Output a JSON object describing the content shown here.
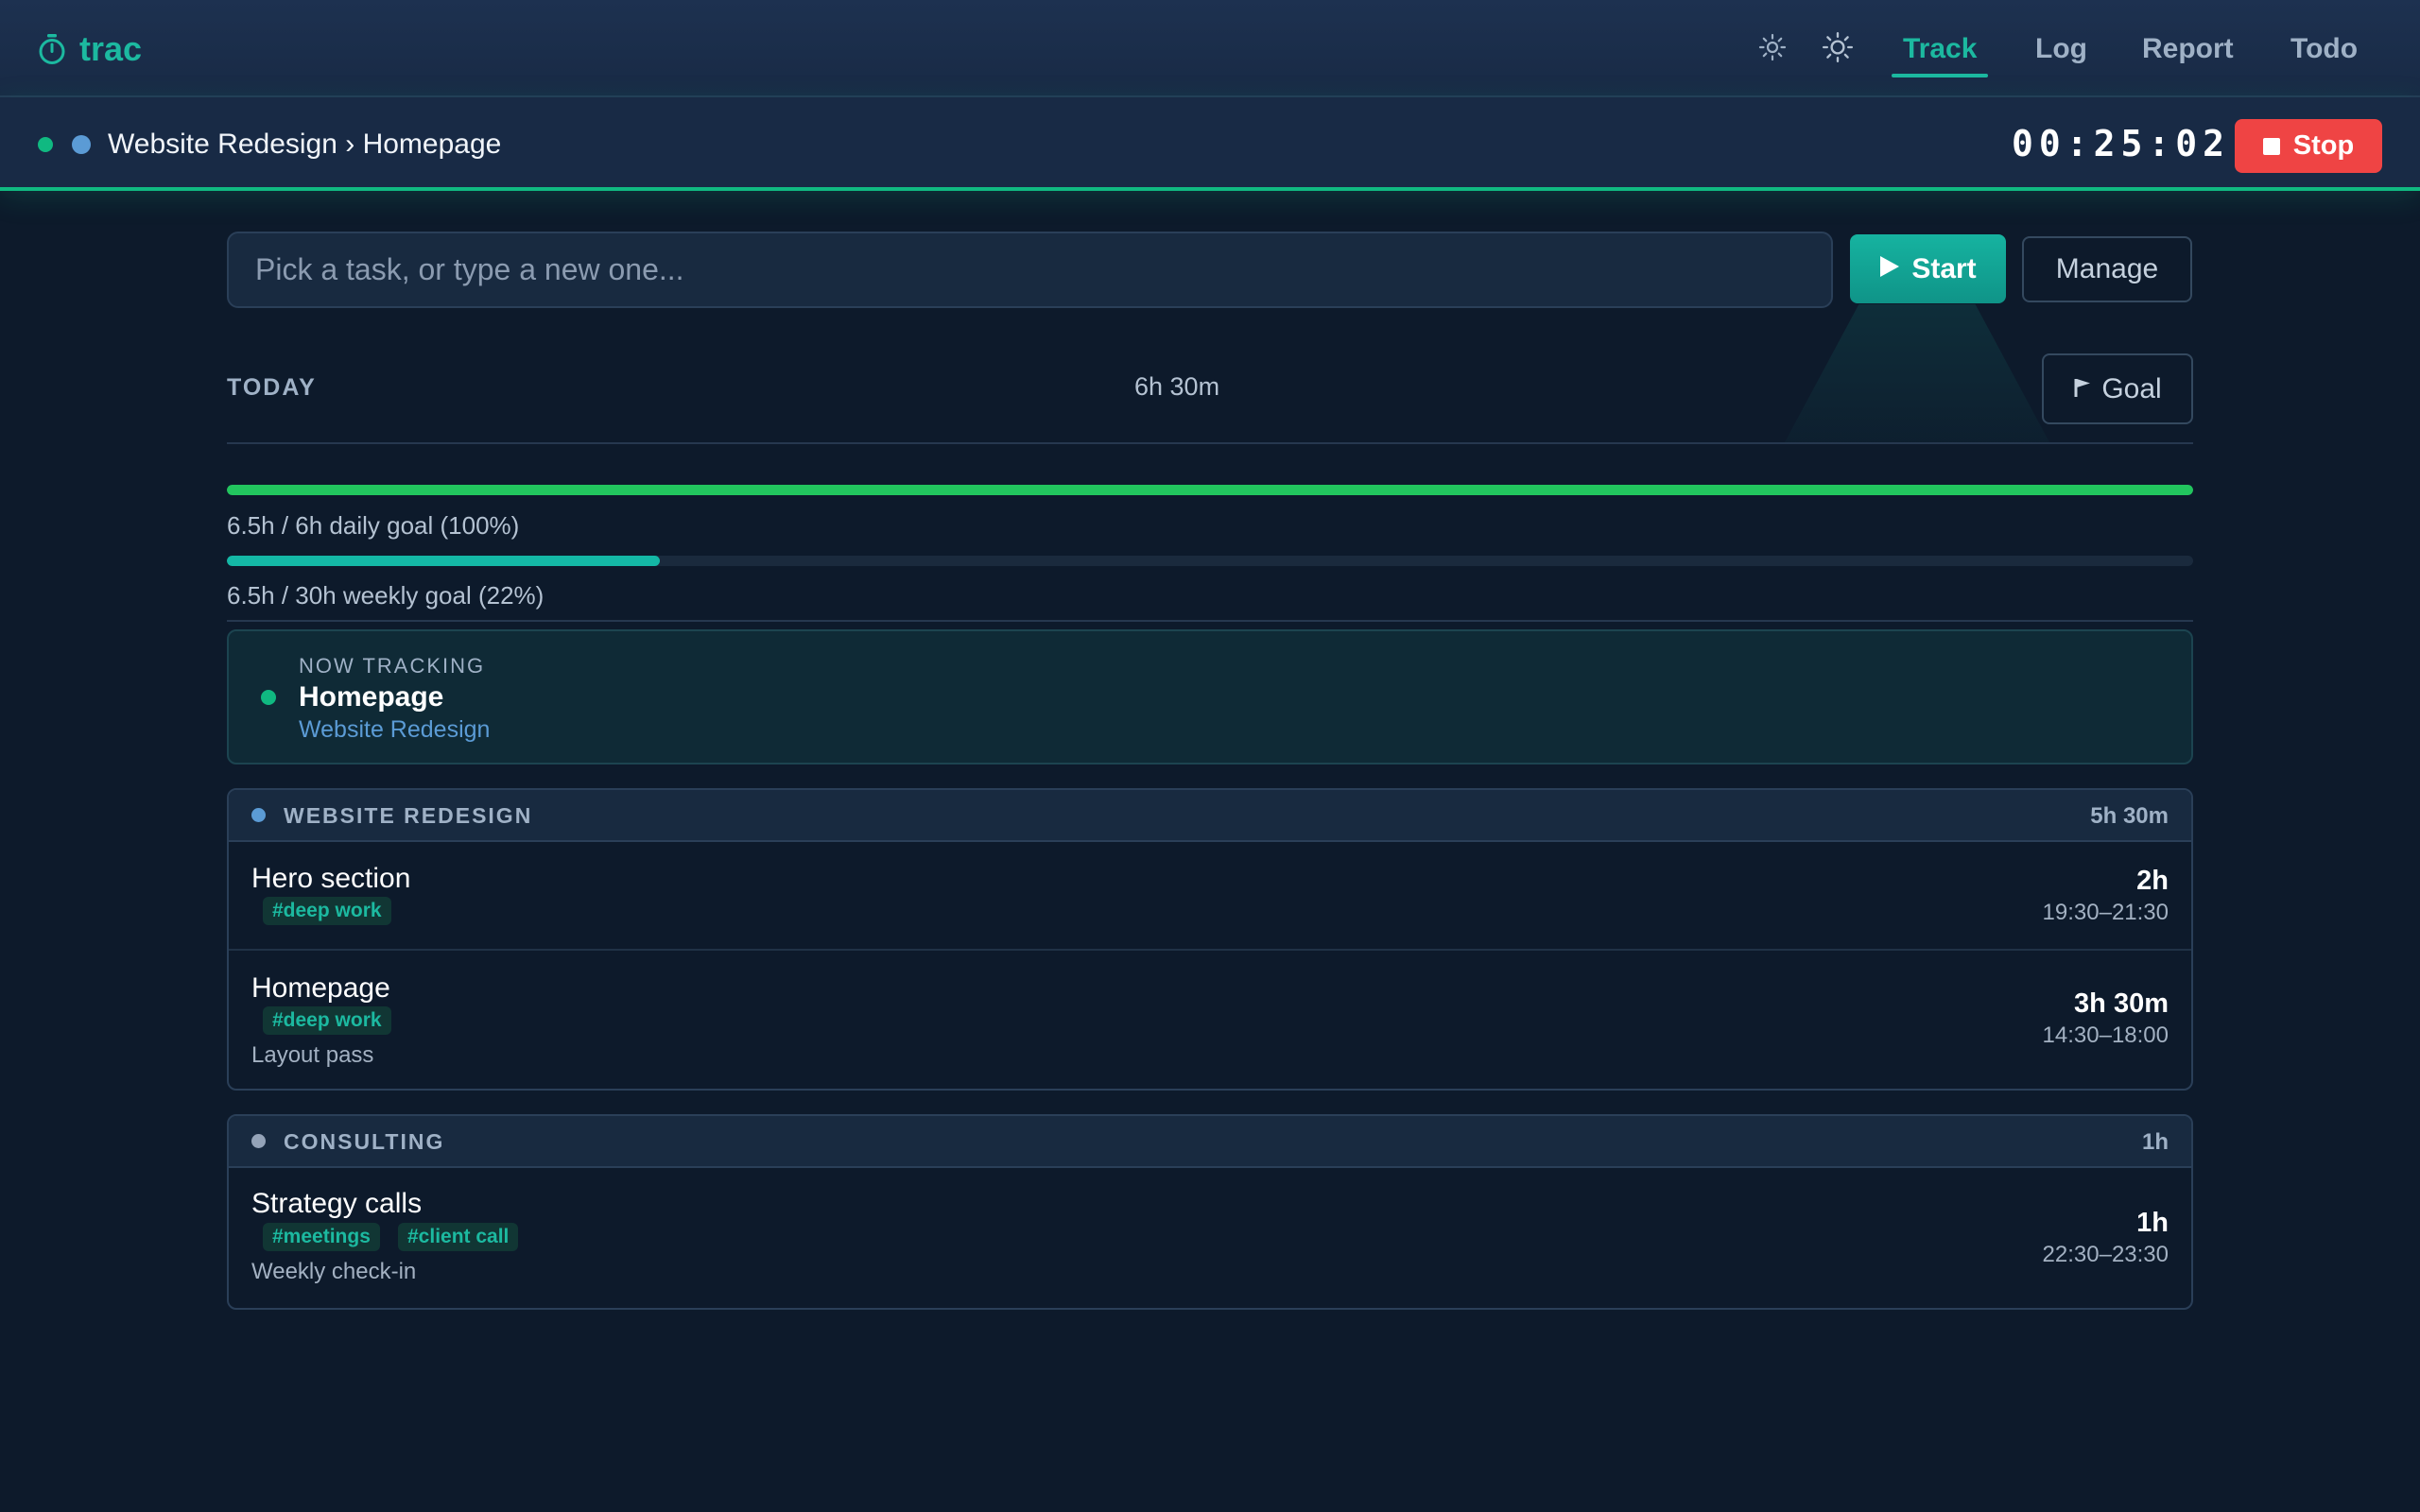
{
  "app": {
    "name": "trac",
    "brand_color": "#1cb9a0",
    "icon": "stopwatch-icon"
  },
  "nav": {
    "theme_icons": [
      "sun-icon",
      "sun-icon"
    ],
    "items": [
      {
        "label": "Track",
        "active": true
      },
      {
        "label": "Log",
        "active": false
      },
      {
        "label": "Report",
        "active": false
      },
      {
        "label": "Todo",
        "active": false
      }
    ]
  },
  "tracking_bar": {
    "breadcrumb": "Website Redesign › Homepage",
    "status_dot_color": "#10b981",
    "project_dot_color": "#5b9bd5",
    "timer": "00:25:02",
    "stop_label": "Stop",
    "stop_color": "#ef4444"
  },
  "task_entry": {
    "placeholder": "Pick a task, or type a new one...",
    "value": "",
    "start_label": "Start",
    "manage_label": "Manage"
  },
  "today": {
    "label": "TODAY",
    "total": "6h 30m",
    "goal_label": "Goal"
  },
  "goals": {
    "daily": {
      "text": "6.5h / 6h daily goal (100%)",
      "progress": 1.0,
      "color": "#22c55e"
    },
    "weekly": {
      "text": "6.5h / 30h weekly goal (22%)",
      "progress": 0.22,
      "color": "#14b8a6"
    }
  },
  "now_tracking": {
    "label": "NOW TRACKING",
    "task": "Homepage",
    "project": "Website Redesign"
  },
  "groups": [
    {
      "name": "WEBSITE REDESIGN",
      "total": "5h 30m",
      "dot_color": "#5b9bd5",
      "entries": [
        {
          "title": "Hero section",
          "tags": [
            "#deep work"
          ],
          "note": "",
          "duration": "2h",
          "range": "19:30–21:30"
        },
        {
          "title": "Homepage",
          "tags": [
            "#deep work"
          ],
          "note": "Layout pass",
          "duration": "3h 30m",
          "range": "14:30–18:00"
        }
      ]
    },
    {
      "name": "CONSULTING",
      "total": "1h",
      "dot_color": "#94a3b8",
      "entries": [
        {
          "title": "Strategy calls",
          "tags": [
            "#meetings",
            "#client call"
          ],
          "note": "Weekly check-in",
          "duration": "1h",
          "range": "22:30–23:30"
        }
      ]
    }
  ]
}
